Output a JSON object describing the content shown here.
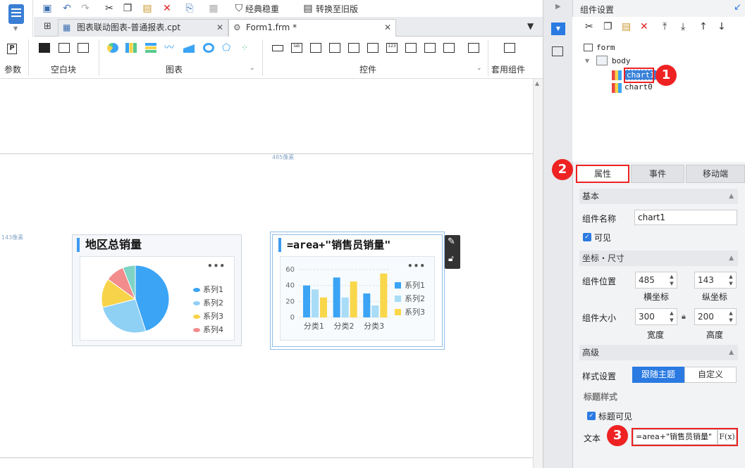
{
  "toolbar": {
    "classic_theme": "经典稳重",
    "switch_old": "转换至旧版"
  },
  "tabs": [
    {
      "label": "图表联动图表-普通报表.cpt"
    },
    {
      "label": "Form1.frm *"
    }
  ],
  "ribbon": {
    "groups": [
      {
        "label": "参数"
      },
      {
        "label": "空白块"
      },
      {
        "label": "图表"
      },
      {
        "label": "控件"
      },
      {
        "label": "套用组件"
      }
    ]
  },
  "canvas": {
    "px_top": "485像素",
    "px_left": "143像素",
    "chart0": {
      "title": "地区总销量",
      "legend": [
        "系列1",
        "系列2",
        "系列3",
        "系列4"
      ],
      "pie_values": [
        45,
        26,
        14,
        9,
        6
      ],
      "colors": [
        "#3ba4f5",
        "#8fd0f5",
        "#f7d34a",
        "#f38c8c",
        "#7fd3c4"
      ]
    },
    "chart1": {
      "title": "=area+\"销售员销量\"",
      "categories": [
        "分类1",
        "分类2",
        "分类3"
      ],
      "y_ticks": [
        "0",
        "20",
        "40",
        "60"
      ],
      "series": [
        {
          "name": "系列1",
          "values": [
            40,
            50,
            30
          ],
          "color": "#3ba4f5"
        },
        {
          "name": "系列2",
          "values": [
            35,
            25,
            15
          ],
          "color": "#a9dcf6"
        },
        {
          "name": "系列3",
          "values": [
            25,
            45,
            55
          ],
          "color": "#f9d74a"
        }
      ],
      "ylim": [
        0,
        60
      ]
    }
  },
  "panel": {
    "title": "组件设置",
    "tree": {
      "form": "form",
      "body": "body",
      "chart1": "chart1",
      "chart0": "chart0"
    },
    "tabs": [
      "属性",
      "事件",
      "移动端"
    ],
    "sections": {
      "basic": "基本",
      "coords": "坐标・尺寸",
      "advanced": "高级",
      "title_style": "标题样式"
    },
    "labels": {
      "name": "组件名称",
      "visible": "可见",
      "position": "组件位置",
      "x": "横坐标",
      "y": "纵坐标",
      "size": "组件大小",
      "width": "宽度",
      "height": "高度",
      "style": "样式设置",
      "title_visible": "标题可见",
      "text": "文本"
    },
    "values": {
      "name": "chart1",
      "pos_x": "485",
      "pos_y": "143",
      "width": "300",
      "height": "200",
      "text": "=area+\"销售员销量\""
    },
    "style_options": [
      "跟随主题",
      "自定义"
    ],
    "fx": "F(x)"
  },
  "badges": [
    "1",
    "2",
    "3"
  ]
}
